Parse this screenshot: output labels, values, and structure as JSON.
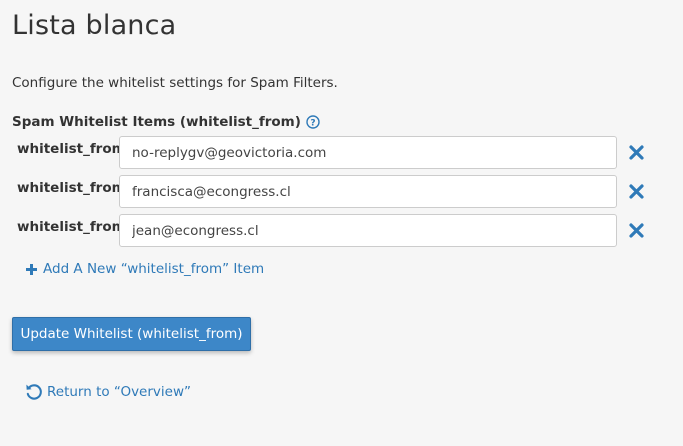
{
  "page": {
    "title": "Lista blanca",
    "description": "Configure the whitelist settings for Spam Filters."
  },
  "section": {
    "label": "Spam Whitelist Items (whitelist_from)"
  },
  "items": [
    {
      "label": "whitelist_from",
      "value": "no-replygv@geovictoria.com"
    },
    {
      "label": "whitelist_from",
      "value": "francisca@econgress.cl"
    },
    {
      "label": "whitelist_from",
      "value": "jean@econgress.cl"
    }
  ],
  "actions": {
    "add_label": "Add A New “whitelist_from” Item",
    "update_label": "Update Whitelist (whitelist_from)",
    "return_label": "Return to “Overview”"
  },
  "icons": {
    "help": "question-circle-icon",
    "remove": "close-x-icon",
    "add": "plus-icon",
    "return": "undo-icon"
  },
  "colors": {
    "background": "#f6f6f6",
    "link": "#2f7ab8",
    "primary_button": "#3d87c8",
    "remove_icon": "#2f7ab8"
  }
}
